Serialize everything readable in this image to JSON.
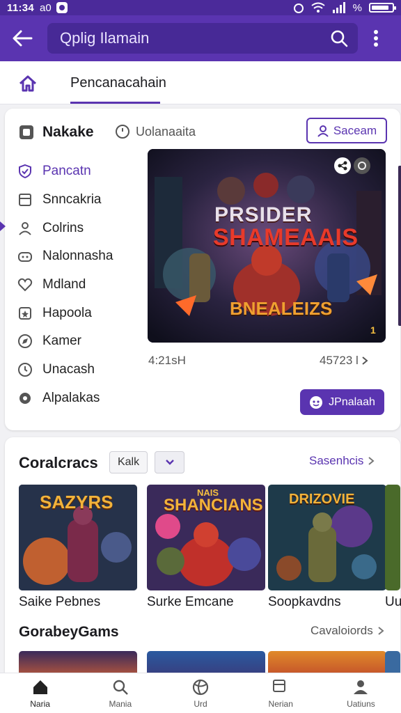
{
  "status_bar": {
    "time": "11:34 ",
    "carrier_glyph": "a0",
    "battery_text": "%",
    "battery_level": 0.85
  },
  "app_bar": {
    "search_placeholder": "Qplig Ilamain"
  },
  "tabs": {
    "active_label": "Pencanacahain"
  },
  "featured": {
    "title": "Nakake",
    "subtitle": "Uolanaaita",
    "follow_label": "Saceam",
    "sidebar": [
      {
        "label": "Pancatn",
        "icon": "shield-check-icon",
        "active": true
      },
      {
        "label": "Snncakria",
        "icon": "square-icon",
        "active": false
      },
      {
        "label": "Colrins",
        "icon": "person-icon",
        "active": false
      },
      {
        "label": "Nalonnasha",
        "icon": "controller-icon",
        "active": false
      },
      {
        "label": "Mdland",
        "icon": "heart-icon",
        "active": false
      },
      {
        "label": "Hapoola",
        "icon": "star-box-icon",
        "active": false
      },
      {
        "label": "Kamer",
        "icon": "compass-icon",
        "active": false
      },
      {
        "label": "Unacash",
        "icon": "clock-icon",
        "active": false
      },
      {
        "label": "Alpalakas",
        "icon": "gear-icon",
        "active": false
      }
    ],
    "hero": {
      "title_line1": "PRSIDER",
      "title_line2": "SHAMEAAIS",
      "bottom_text": "BNEALEIZS",
      "badge": "1"
    },
    "meta_left": "4:21sH",
    "meta_right": "45723 l",
    "play_label": "JPnalaah"
  },
  "section1": {
    "title": "Coralcracs",
    "chip": "Kalk",
    "link": "Sasenhcis",
    "tiles": [
      {
        "art_title": "SAZYRS",
        "label": "Saike Pebnes"
      },
      {
        "art_title": "SHANCIANS",
        "art_sub": "NAIS",
        "label": "Surke Emcane"
      },
      {
        "art_title": "DRIZOVIE",
        "label": "Soopkavdns"
      },
      {
        "label": "Uu"
      }
    ]
  },
  "section2": {
    "title": "GorabeyGams",
    "link": "Cavaloiords"
  },
  "bottom_nav": [
    {
      "label": "Naria",
      "icon": "home-icon"
    },
    {
      "label": "Mania",
      "icon": "search-icon"
    },
    {
      "label": "Urd",
      "icon": "globe-icon"
    },
    {
      "label": "Nerian",
      "icon": "square-icon"
    },
    {
      "label": "Uatiuns",
      "icon": "profile-icon"
    }
  ],
  "colors": {
    "accent": "#5a34b0",
    "accent_dark": "#4b2a9a",
    "background": "#f1f1f4"
  }
}
